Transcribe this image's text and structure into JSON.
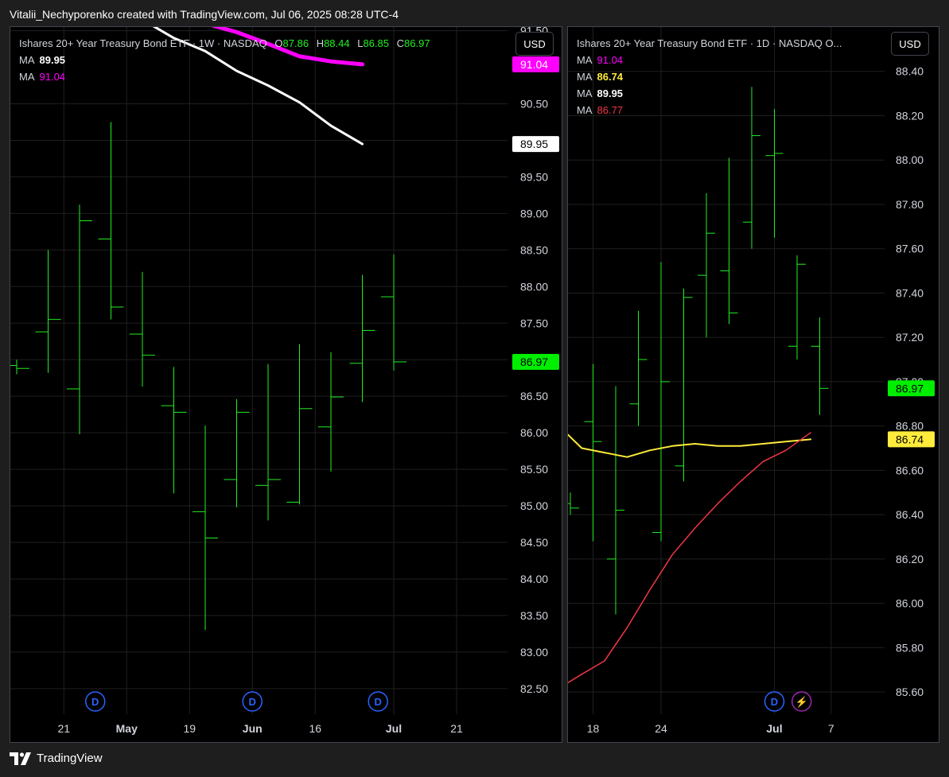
{
  "header": {
    "text": "Vitalii_Nechyporenko created with TradingView.com, Jul 06, 2025 08:28 UTC-4"
  },
  "footer": {
    "brand": "TradingView"
  },
  "colors": {
    "up": "#22ee22",
    "grid": "#1f1f1f",
    "ma_white": "#ffffff",
    "ma_magenta": "#ff00ff",
    "ma_yellow": "#ffeb3b",
    "ma_red": "#f23645",
    "price_bg": "#00ee00",
    "dividend": "#2962ff",
    "split": "#9c27b0"
  },
  "panels": [
    {
      "id": "left",
      "currency": "USD",
      "legend": {
        "title": "Ishares 20+ Year Treasury Bond ETF · 1W · NASDAQ",
        "ohlc": [
          {
            "label": "O",
            "value": "87.86"
          },
          {
            "label": "H",
            "value": "88.44"
          },
          {
            "label": "L",
            "value": "86.85"
          },
          {
            "label": "C",
            "value": "86.97"
          }
        ],
        "ma": [
          {
            "label": "MA",
            "value": "89.95",
            "color": "#ffffff"
          },
          {
            "label": "MA",
            "value": "91.04",
            "color": "#ff00ff"
          }
        ]
      },
      "chart_data": {
        "type": "ohlc",
        "ylim": [
          82.15,
          91.55
        ],
        "yticks": [
          "82.50",
          "83.00",
          "83.50",
          "84.00",
          "84.50",
          "85.00",
          "85.50",
          "86.00",
          "86.50",
          "87.00",
          "87.50",
          "88.00",
          "88.50",
          "89.00",
          "89.50",
          "90.00",
          "90.50",
          "91.50"
        ],
        "ytick_values": [
          82.5,
          83.0,
          83.5,
          84.0,
          84.5,
          85.0,
          85.5,
          86.0,
          86.5,
          87.0,
          87.5,
          88.0,
          88.5,
          89.0,
          89.5,
          90.0,
          90.5,
          91.5
        ],
        "xlabels": [
          {
            "text": "21",
            "index": 1.5,
            "bold": false
          },
          {
            "text": "May",
            "index": 3.5,
            "bold": true
          },
          {
            "text": "19",
            "index": 5.5,
            "bold": false
          },
          {
            "text": "Jun",
            "index": 7.5,
            "bold": true
          },
          {
            "text": "16",
            "index": 9.5,
            "bold": false
          },
          {
            "text": "Jul",
            "index": 12,
            "bold": true
          },
          {
            "text": "21",
            "index": 14,
            "bold": false
          }
        ],
        "vgrid": [
          1.5,
          3.5,
          5.5,
          7.5,
          9.5,
          12,
          14
        ],
        "bars": [
          {
            "o": 86.92,
            "h": 87.0,
            "l": 86.8,
            "c": 86.88
          },
          {
            "o": 87.38,
            "h": 88.5,
            "l": 86.82,
            "c": 87.55
          },
          {
            "o": 86.6,
            "h": 89.12,
            "l": 85.98,
            "c": 88.9
          },
          {
            "o": 88.65,
            "h": 90.25,
            "l": 87.55,
            "c": 87.72
          },
          {
            "o": 87.35,
            "h": 88.2,
            "l": 86.63,
            "c": 87.06
          },
          {
            "o": 86.37,
            "h": 86.9,
            "l": 85.17,
            "c": 86.28
          },
          {
            "o": 84.92,
            "h": 86.1,
            "l": 83.3,
            "c": 84.56
          },
          {
            "o": 85.36,
            "h": 86.46,
            "l": 84.98,
            "c": 86.28
          },
          {
            "o": 85.28,
            "h": 86.94,
            "l": 84.8,
            "c": 85.36
          },
          {
            "o": 85.05,
            "h": 87.21,
            "l": 85.02,
            "c": 86.33
          },
          {
            "o": 86.08,
            "h": 87.1,
            "l": 85.47,
            "c": 86.49
          },
          {
            "o": 86.95,
            "h": 88.16,
            "l": 86.42,
            "c": 87.4
          },
          {
            "o": 87.86,
            "h": 88.44,
            "l": 86.85,
            "c": 86.97
          }
        ],
        "ma_series": [
          {
            "color": "#ffffff",
            "width": 3,
            "start": 4,
            "values": [
              91.65,
              91.4,
              91.22,
              90.95,
              90.75,
              90.52,
              90.2,
              89.95
            ]
          },
          {
            "color": "#ff00ff",
            "width": 5,
            "start": 4,
            "values": [
              91.72,
              91.65,
              91.6,
              91.48,
              91.32,
              91.15,
              91.08,
              91.04
            ]
          }
        ],
        "price_labels": [
          {
            "value": 91.04,
            "text": "91.04",
            "bg": "#ff00ff",
            "fg": "#ffffff"
          },
          {
            "value": 89.95,
            "text": "89.95",
            "bg": "#ffffff",
            "fg": "#000000"
          },
          {
            "value": 86.97,
            "text": "86.97",
            "bg": "#00ee00",
            "fg": "#000000"
          }
        ],
        "events": [
          {
            "type": "dividend",
            "text": "D",
            "index": 2.5
          },
          {
            "type": "dividend",
            "text": "D",
            "index": 7.5
          },
          {
            "type": "dividend",
            "text": "D",
            "index": 11.5
          }
        ]
      }
    },
    {
      "id": "right",
      "currency": "USD",
      "legend": {
        "title": "Ishares 20+ Year Treasury Bond ETF · 1D · NASDAQ  O...",
        "ohlc": [],
        "ma": [
          {
            "label": "MA",
            "value": "91.04",
            "color": "#ff00ff"
          },
          {
            "label": "MA",
            "value": "86.74",
            "color": "#ffeb3b"
          },
          {
            "label": "MA",
            "value": "89.95",
            "color": "#ffffff"
          },
          {
            "label": "MA",
            "value": "86.77",
            "color": "#f23645"
          }
        ]
      },
      "chart_data": {
        "type": "ohlc",
        "ylim": [
          85.5,
          88.6
        ],
        "yticks": [
          "85.60",
          "85.80",
          "86.00",
          "86.20",
          "86.40",
          "86.60",
          "86.80",
          "87.00",
          "87.20",
          "87.40",
          "87.60",
          "87.80",
          "88.00",
          "88.20",
          "88.40"
        ],
        "ytick_values": [
          85.6,
          85.8,
          86.0,
          86.2,
          86.4,
          86.6,
          86.8,
          87.0,
          87.2,
          87.4,
          87.6,
          87.8,
          88.0,
          88.2,
          88.4
        ],
        "xlabels": [
          {
            "text": "18",
            "index": 1,
            "bold": false
          },
          {
            "text": "24",
            "index": 4,
            "bold": false
          },
          {
            "text": "Jul",
            "index": 9,
            "bold": true
          },
          {
            "text": "7",
            "index": 11.5,
            "bold": false
          }
        ],
        "vgrid": [
          1,
          4,
          9,
          11.5
        ],
        "bars": [
          {
            "o": 86.45,
            "h": 86.5,
            "l": 86.4,
            "c": 86.43
          },
          {
            "o": 86.82,
            "h": 87.08,
            "l": 86.28,
            "c": 86.73
          },
          {
            "o": 86.2,
            "h": 86.98,
            "l": 85.95,
            "c": 86.42
          },
          {
            "o": 86.9,
            "h": 87.32,
            "l": 86.8,
            "c": 87.1
          },
          {
            "o": 86.32,
            "h": 87.54,
            "l": 86.28,
            "c": 87.0
          },
          {
            "o": 86.62,
            "h": 87.42,
            "l": 86.55,
            "c": 87.38
          },
          {
            "o": 87.48,
            "h": 87.85,
            "l": 87.2,
            "c": 87.67
          },
          {
            "o": 87.5,
            "h": 88.01,
            "l": 87.26,
            "c": 87.31
          },
          {
            "o": 87.72,
            "h": 88.33,
            "l": 87.6,
            "c": 88.11
          },
          {
            "o": 88.02,
            "h": 88.23,
            "l": 87.65,
            "c": 88.03
          },
          {
            "o": 87.16,
            "h": 87.57,
            "l": 87.1,
            "c": 87.53
          },
          {
            "o": 87.16,
            "h": 87.29,
            "l": 86.85,
            "c": 86.97
          }
        ],
        "ma_series": [
          {
            "color": "#ffeb3b",
            "width": 2,
            "start": -0.3,
            "step": 1,
            "values": [
              86.78,
              86.7,
              86.68,
              86.66,
              86.69,
              86.71,
              86.72,
              86.71,
              86.71,
              86.72,
              86.73,
              86.74
            ]
          },
          {
            "color": "#f23645",
            "width": 1.5,
            "start": -0.3,
            "step": 1,
            "values": [
              85.63,
              85.68,
              85.74,
              85.89,
              86.06,
              86.22,
              86.34,
              86.45,
              86.55,
              86.64,
              86.69,
              86.77
            ]
          }
        ],
        "ma_x": [
          -0.3,
          0.5,
          1.5,
          2.5,
          3.5,
          4.5,
          5.5,
          6.5,
          7.5,
          8.5,
          9.5,
          10.6
        ],
        "price_labels": [
          {
            "value": 86.97,
            "text": "86.97",
            "bg": "#00ee00",
            "fg": "#000000"
          },
          {
            "value": 86.74,
            "text": "86.74",
            "bg": "#ffeb3b",
            "fg": "#000000"
          }
        ],
        "events": [
          {
            "type": "dividend",
            "text": "D",
            "index": 9
          },
          {
            "type": "split",
            "text": "⚡",
            "index": 10.2
          }
        ]
      }
    }
  ]
}
